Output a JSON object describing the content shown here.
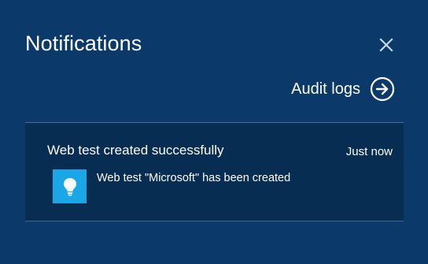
{
  "panel": {
    "title": "Notifications",
    "close_icon": "close-icon"
  },
  "audit": {
    "label": "Audit logs",
    "icon": "arrow-right-circle-icon"
  },
  "notification": {
    "title": "Web test created successfully",
    "time": "Just now",
    "message": "Web test \"Microsoft\" has been created",
    "icon": "lightbulb-icon",
    "icon_color": "#1aa7e8"
  },
  "colors": {
    "background": "#0b3a6a",
    "card_background": "#082d52"
  }
}
